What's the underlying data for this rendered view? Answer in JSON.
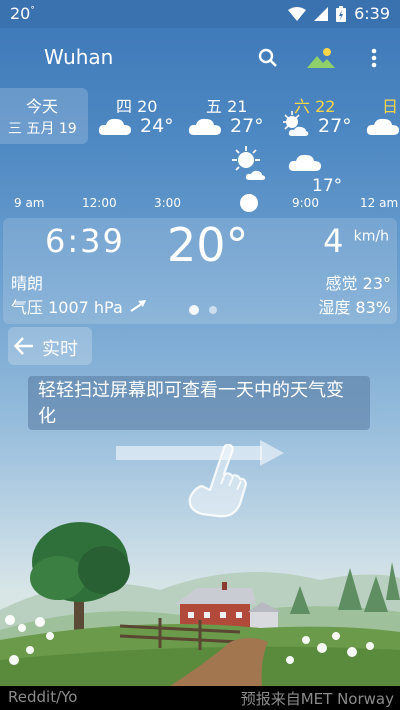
{
  "status_bar": {
    "time_small": "20",
    "degree": "°",
    "clock": "6:39"
  },
  "header": {
    "city": "Wuhan"
  },
  "days": [
    {
      "name": "今天",
      "date": "三 五月 19"
    },
    {
      "name": "四 20",
      "temp": "24°",
      "icon": "cloud-icon"
    },
    {
      "name": "五 21",
      "temp": "27°",
      "icon": "cloud-icon"
    },
    {
      "name": "六 22",
      "temp": "27°",
      "icon": "sun-cloud-icon",
      "color": "#ffd54a"
    },
    {
      "name": "日",
      "icon": "cloud-icon",
      "color": "#ffd54a"
    }
  ],
  "hourly": {
    "labels": [
      "9 am",
      "12:00",
      "3:00",
      "9:00",
      "12 am"
    ],
    "temp": "17°"
  },
  "current": {
    "time": "6:39",
    "temp": "20°",
    "wind": "4",
    "wind_unit": "km/h",
    "condition": "晴朗",
    "feels": "感觉 23°",
    "pressure": "气压 1007 hPa",
    "humidity": "湿度 83%"
  },
  "realtime": {
    "label": "实时"
  },
  "hint": {
    "text": "轻轻扫过屏幕即可查看一天中的天气变化"
  },
  "footer": {
    "left": "Reddit/Yo",
    "right": "预报来自MET Norway"
  },
  "colors": {
    "sky_top": "#3c77b7",
    "accent_weekend": "#ffd54a"
  }
}
